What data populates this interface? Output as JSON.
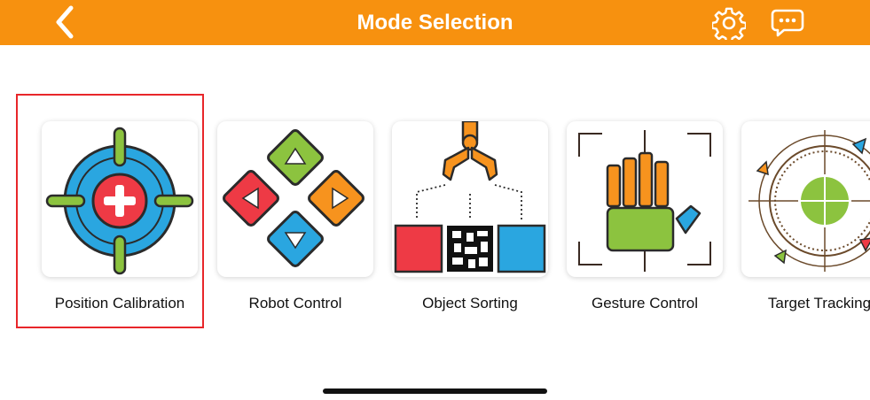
{
  "header": {
    "title": "Mode Selection",
    "back_icon": "chevron-left-icon",
    "settings_icon": "gear-icon",
    "chat_icon": "chat-bubble-icon"
  },
  "modes": [
    {
      "label": "Position Calibration",
      "icon": "crosshair-target-icon",
      "selected": true
    },
    {
      "label": "Robot Control",
      "icon": "direction-pad-icon",
      "selected": false
    },
    {
      "label": "Object Sorting",
      "icon": "gripper-sorting-icon",
      "selected": false
    },
    {
      "label": "Gesture Control",
      "icon": "hand-gesture-icon",
      "selected": false
    },
    {
      "label": "Target Tracking",
      "icon": "tracking-reticle-icon",
      "selected": false
    }
  ],
  "colors": {
    "header_bg": "#f7910f",
    "selection_border": "#e8262a",
    "red": "#ee3a45",
    "green": "#8cc33f",
    "blue": "#2aa6e0",
    "orange": "#f7931e",
    "outline": "#2b2b2b"
  }
}
